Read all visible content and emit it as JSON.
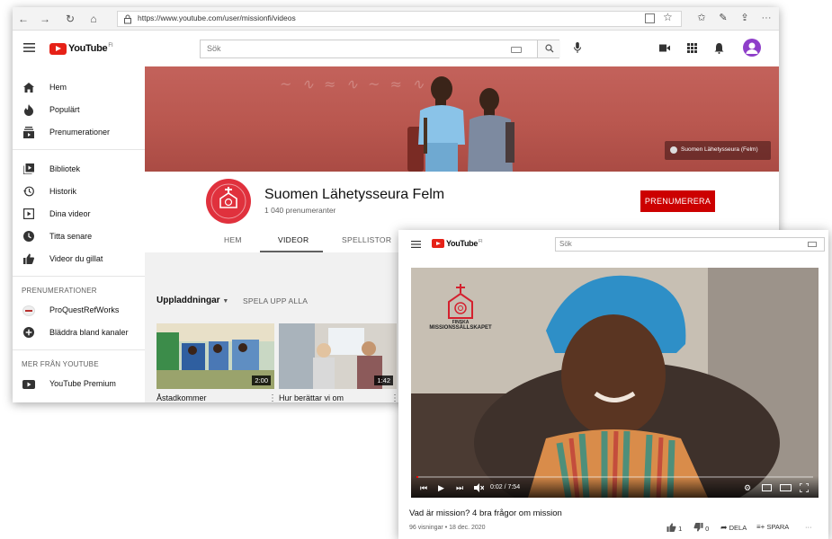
{
  "browser": {
    "url": "https://www.youtube.com/user/missionfi/videos",
    "nav": {
      "back": "←",
      "forward": "→",
      "refresh": "↻",
      "home": "⌂"
    }
  },
  "youtube": {
    "logo_text": "YouTube",
    "logo_region": "FI",
    "search_placeholder": "Sök"
  },
  "sidebar": {
    "items": [
      {
        "label": "Hem",
        "icon": "home-icon"
      },
      {
        "label": "Populärt",
        "icon": "fire-icon"
      },
      {
        "label": "Prenumerationer",
        "icon": "subscriptions-icon"
      },
      {
        "label": "Bibliotek",
        "icon": "library-icon"
      },
      {
        "label": "Historik",
        "icon": "history-icon"
      },
      {
        "label": "Dina videor",
        "icon": "your-videos-icon"
      },
      {
        "label": "Titta senare",
        "icon": "watch-later-icon"
      },
      {
        "label": "Videor du gillat",
        "icon": "thumbs-up-icon"
      }
    ],
    "subscriptions_heading": "PRENUMERATIONER",
    "subscriptions": [
      {
        "label": "ProQuestRefWorks",
        "icon": "channel-avatar-icon"
      },
      {
        "label": "Bläddra bland kanaler",
        "icon": "plus-circle-icon"
      }
    ],
    "more_heading": "MER FRÅN YOUTUBE",
    "more": [
      {
        "label": "YouTube Premium",
        "icon": "youtube-icon"
      }
    ]
  },
  "banner": {
    "tag": "Suomen Lähetysseura (Felm)"
  },
  "channel": {
    "name": "Suomen Lähetysseura Felm",
    "subscribers": "1 040 prenumeranter",
    "subscribe_label": "PRENUMERERA",
    "tabs": [
      "HEM",
      "VIDEOR",
      "SPELLISTOR"
    ],
    "active_tab": "VIDEOR"
  },
  "uploads": {
    "heading": "Uppladdningar",
    "play_all": "SPELA UPP ALLA",
    "videos": [
      {
        "title": "Åstadkommer",
        "duration": "2:00"
      },
      {
        "title": "Hur berättar vi om",
        "duration": "1:42"
      }
    ]
  },
  "watch": {
    "logo_text": "YouTube",
    "logo_region": "FI",
    "search_placeholder": "Sök",
    "watermark_line1": "FINSKA",
    "watermark_line2": "MISSIONSSÄLLSKAPET",
    "time": "0:02 / 7:54",
    "progress": 0.004,
    "title": "Vad är mission? 4 bra frågor om mission",
    "meta": "96 visningar • 18 dec. 2020",
    "likes": "1",
    "dislikes": "0",
    "share_label": "DELA",
    "save_label": "SPARA"
  },
  "colors": {
    "youtube_red": "#e62117",
    "subscribe_red": "#cc0000",
    "banner": "#b9574f",
    "avatar": "#e0313d"
  }
}
